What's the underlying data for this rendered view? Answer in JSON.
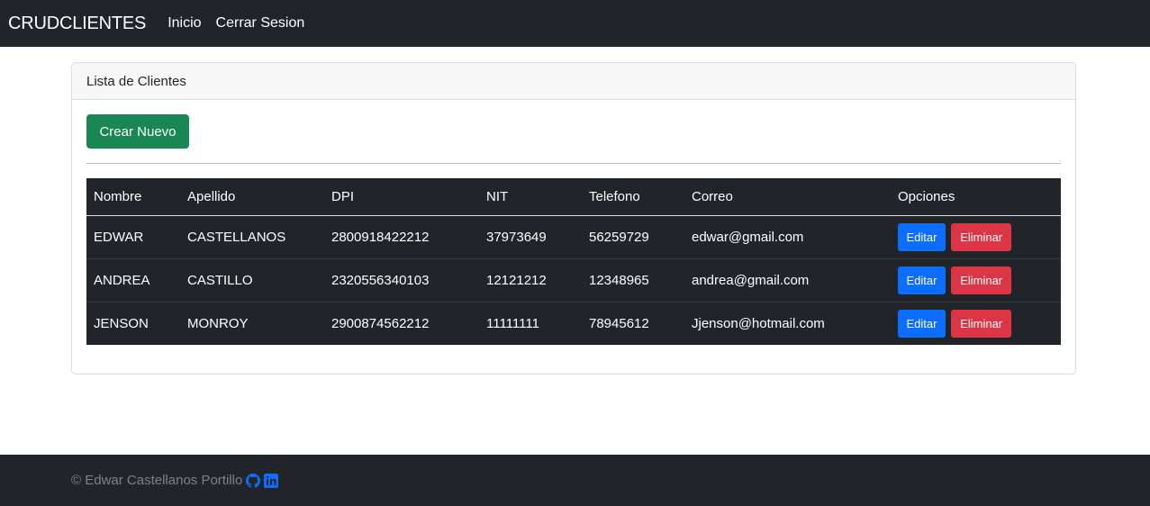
{
  "navbar": {
    "brand": "CRUDCLIENTES",
    "links": [
      "Inicio",
      "Cerrar Sesion"
    ]
  },
  "card": {
    "header": "Lista de Clientes",
    "create_button": "Crear Nuevo"
  },
  "table": {
    "headers": [
      "Nombre",
      "Apellido",
      "DPI",
      "NIT",
      "Telefono",
      "Correo",
      "Opciones"
    ],
    "rows": [
      [
        "EDWAR",
        "CASTELLANOS",
        "2800918422212",
        "37973649",
        "56259729",
        "edwar@gmail.com"
      ],
      [
        "ANDREA",
        "CASTILLO",
        "2320556340103",
        "12121212",
        "12348965",
        "andrea@gmail.com"
      ],
      [
        "JENSON",
        "MONROY",
        "2900874562212",
        "11111111",
        "78945612",
        "Jjenson@hotmail.com"
      ]
    ],
    "edit_label": "Editar",
    "delete_label": "Eliminar"
  },
  "footer": {
    "text": "© Edwar Castellanos Portillo",
    "icons": [
      "github-icon",
      "linkedin-icon"
    ]
  },
  "colors": {
    "navbar_bg": "#212529",
    "success": "#198754",
    "primary": "#0d6efd",
    "danger": "#dc3545",
    "footer_icon": "#0d6efd"
  }
}
